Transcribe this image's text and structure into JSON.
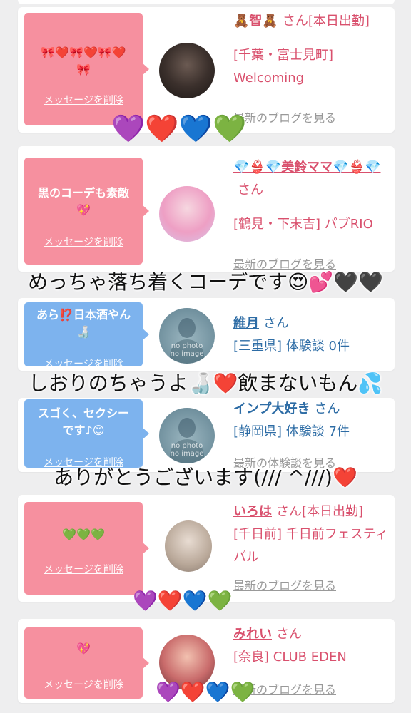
{
  "cards": [
    {
      "message": "🎀❤️🎀❤️🎀❤️\n🎀",
      "delete_label": "メッセージを削除",
      "name": "🧸智🧸",
      "san": "さん[本日出勤]",
      "line2": "[千葉・富士見町] Welcoming",
      "link": "最新のブログを見る"
    },
    {
      "message": "黒のコーデも素敵\n💖",
      "delete_label": "メッセージを削除",
      "name": "💎👙💎美鈴ママ💎👙💎",
      "san": "さん",
      "line2": "[鶴見・下末吉] パブRIO",
      "link": "最新のブログを見る"
    },
    {
      "message": "あら⁉️日本酒やん\n🍶",
      "delete_label": "メッセージを削除",
      "name": "維月",
      "san": "さん",
      "line2": "[三重県] 体験談 0件",
      "nophoto": "no photo\nno image"
    },
    {
      "message": "スゴく、セクシー\nです♪😊",
      "delete_label": "メッセージを削除",
      "name": "インプ大好き",
      "san": "さん",
      "line2": "[静岡県] 体験談 7件",
      "nophoto": "no photo\nno image",
      "link": "最新の体験談を見る"
    },
    {
      "message": "💚💚💚",
      "delete_label": "メッセージを削除",
      "name": "いろは",
      "san": "さん[本日出勤]",
      "line2": "[千日前] 千日前フェスティバル",
      "link": "最新のブログを見る"
    },
    {
      "message": "💖",
      "delete_label": "メッセージを削除",
      "name": "みれい",
      "san": "さん",
      "line2": "[奈良] CLUB EDEN",
      "link": "最新のブログを見る"
    }
  ],
  "overlays": {
    "text1": "めっちゃ落ち着くコーデです😍💕🖤🖤",
    "text2": "しおりのちゃうよ🍶❤️飲まないもん💦",
    "text3": "ありがとうございます(/// ^///)❤️",
    "hearts1": "💜❤️💙💚",
    "hearts2": "💜❤️💙💚",
    "hearts3": "💜❤️💙💚"
  },
  "colors": {
    "pink_bubble": "#f6909f",
    "blue_bubble": "#7db3ee",
    "pink_text": "#d9506d",
    "blue_text": "#2d6ca5",
    "link_gray": "#999999"
  }
}
